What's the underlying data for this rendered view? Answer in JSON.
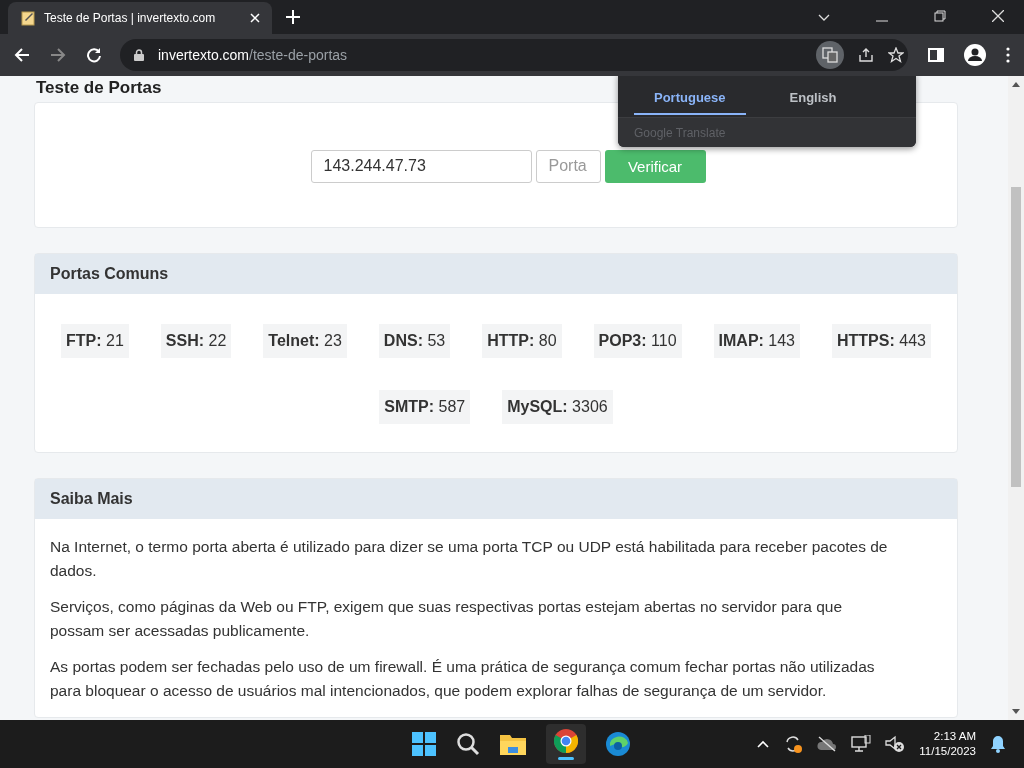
{
  "browser": {
    "tab_title": "Teste de Portas | invertexto.com",
    "url_host": "invertexto.com",
    "url_path": "/teste-de-portas"
  },
  "translate_popup": {
    "tabs": [
      {
        "label": "Portuguese",
        "selected": true
      },
      {
        "label": "English",
        "selected": false
      }
    ],
    "footer": "Google Translate"
  },
  "page": {
    "heading": "Teste de Portas",
    "form": {
      "ip_value": "143.244.47.73",
      "port_placeholder": "Porta",
      "button": "Verificar"
    },
    "common_ports": {
      "title": "Portas Comuns",
      "ports": [
        {
          "name": "FTP:",
          "number": "21"
        },
        {
          "name": "SSH:",
          "number": "22"
        },
        {
          "name": "Telnet:",
          "number": "23"
        },
        {
          "name": "DNS:",
          "number": "53"
        },
        {
          "name": "HTTP:",
          "number": "80"
        },
        {
          "name": "POP3:",
          "number": "110"
        },
        {
          "name": "IMAP:",
          "number": "143"
        },
        {
          "name": "HTTPS:",
          "number": "443"
        },
        {
          "name": "SMTP:",
          "number": "587"
        },
        {
          "name": "MySQL:",
          "number": "3306"
        }
      ]
    },
    "more": {
      "title": "Saiba Mais",
      "paragraphs": [
        "Na Internet, o termo porta aberta é utilizado para dizer se uma porta TCP ou UDP está habilitada para receber pacotes de dados.",
        "Serviços, como páginas da Web ou FTP, exigem que suas respectivas portas estejam abertas no servidor para que possam ser acessadas publicamente.",
        "As portas podem ser fechadas pelo uso de um firewall. É uma prática de segurança comum fechar portas não utilizadas para bloquear o acesso de usuários mal intencionados, que podem explorar falhas de segurança de um servidor."
      ]
    }
  },
  "taskbar": {
    "time": "2:13 AM",
    "date": "11/15/2023"
  }
}
